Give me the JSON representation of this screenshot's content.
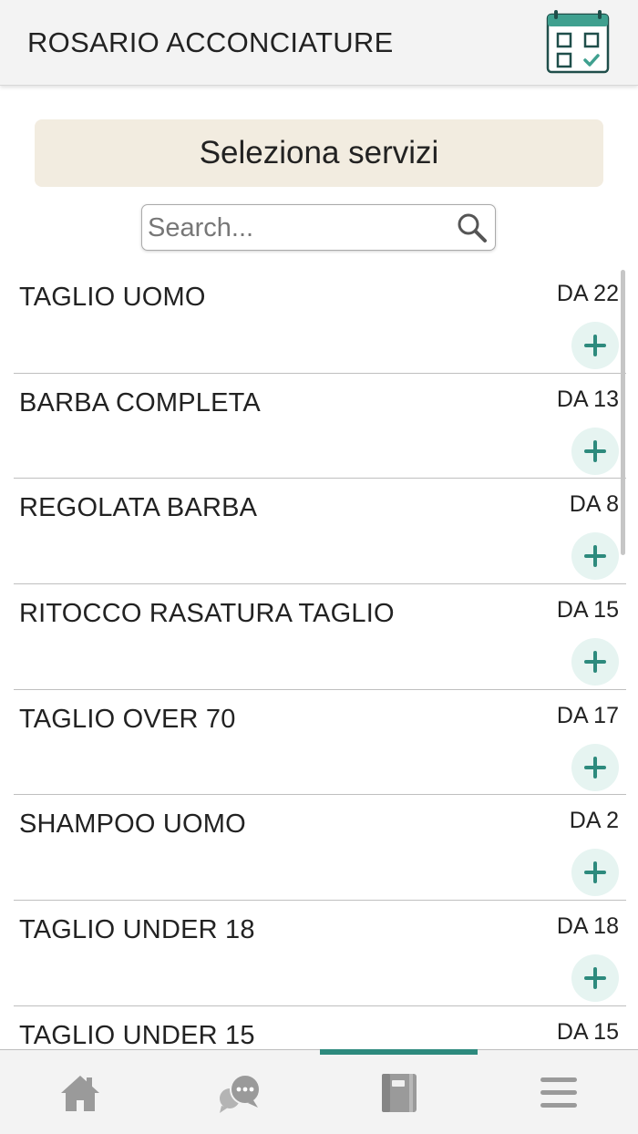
{
  "header": {
    "title": "ROSARIO ACCONCIATURE",
    "calendar_icon": "calendar-check-icon"
  },
  "section": {
    "title": "Seleziona servizi"
  },
  "search": {
    "placeholder": "Search...",
    "value": "",
    "icon": "search-icon"
  },
  "services": [
    {
      "name": "TAGLIO UOMO",
      "price": "DA 22"
    },
    {
      "name": "BARBA COMPLETA",
      "price": "DA 13"
    },
    {
      "name": "REGOLATA BARBA",
      "price": "DA 8"
    },
    {
      "name": "RITOCCO RASATURA TAGLIO",
      "price": "DA 15"
    },
    {
      "name": "TAGLIO OVER 70",
      "price": "DA 17"
    },
    {
      "name": "SHAMPOO UOMO",
      "price": "DA 2"
    },
    {
      "name": "TAGLIO UNDER 18",
      "price": "DA 18"
    },
    {
      "name": "TAGLIO UNDER 15",
      "price": "DA 15"
    }
  ],
  "tabbar": {
    "tabs": [
      {
        "icon": "home-icon",
        "active": false
      },
      {
        "icon": "chat-bubbles-icon",
        "active": false
      },
      {
        "icon": "notebook-icon",
        "active": true
      },
      {
        "icon": "hamburger-menu-icon",
        "active": false
      }
    ]
  },
  "colors": {
    "accent": "#2d8a7d",
    "section_bar": "#f2ece0",
    "add_button_bg": "#e6f4f1",
    "tab_icon": "#9a9a9a"
  }
}
